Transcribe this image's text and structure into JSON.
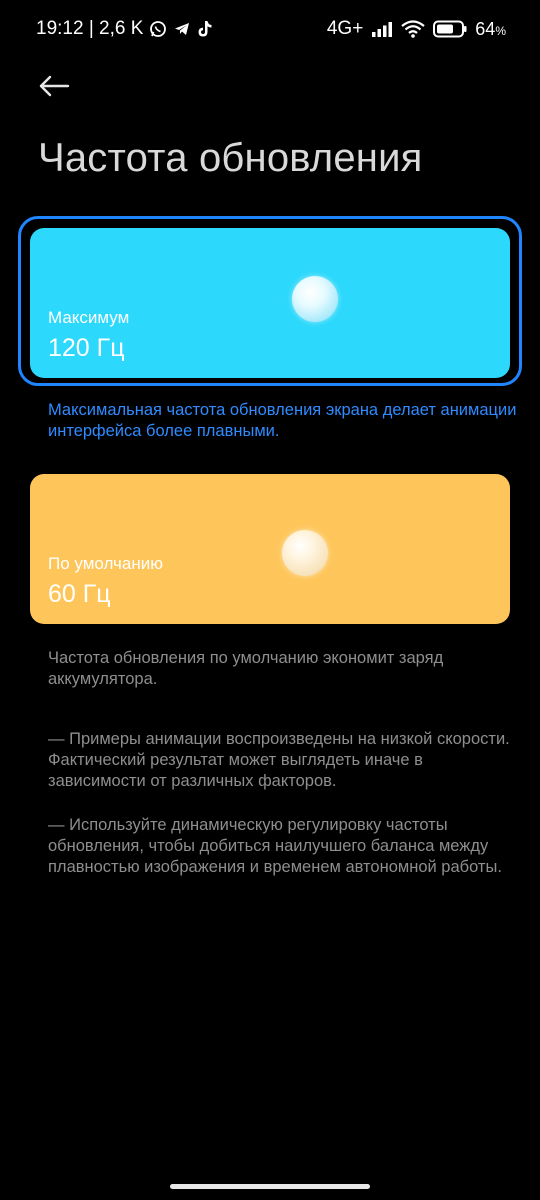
{
  "status_bar": {
    "time_info": "19:12 | 2,6 K",
    "network": "4G+",
    "battery_percent": "64",
    "battery_suffix": "%",
    "icons": [
      "whatsapp-icon",
      "telegram-icon",
      "tiktok-icon",
      "signal-icon",
      "wifi-icon",
      "battery-icon"
    ]
  },
  "header": {
    "back_icon": "arrow-left-icon",
    "title": "Частота обновления"
  },
  "options": [
    {
      "label": "Максимум",
      "value": "120 Гц",
      "color": "#2cd8fb",
      "selected": true,
      "description": "Максимальная частота обновления экрана делает анимации интерфейса более плавными."
    },
    {
      "label": "По умолчанию",
      "value": "60 Гц",
      "color": "#fec65a",
      "selected": false,
      "description": "Частота обновления по умолчанию экономит заряд аккумулятора."
    }
  ],
  "notes": [
    "— Примеры анимации воспроизведены на низкой скорости. Фактический результат может выглядеть иначе в зависимости от различных факторов.",
    "— Используйте динамическую регулировку частоты обновления, чтобы добиться наилучшего баланса между плавностью изображения и временем автономной работы."
  ],
  "colors": {
    "selection_outline": "#1f86ff",
    "description_selected": "#2f8bff",
    "description_muted": "#8e8e8e",
    "background": "#000000"
  }
}
